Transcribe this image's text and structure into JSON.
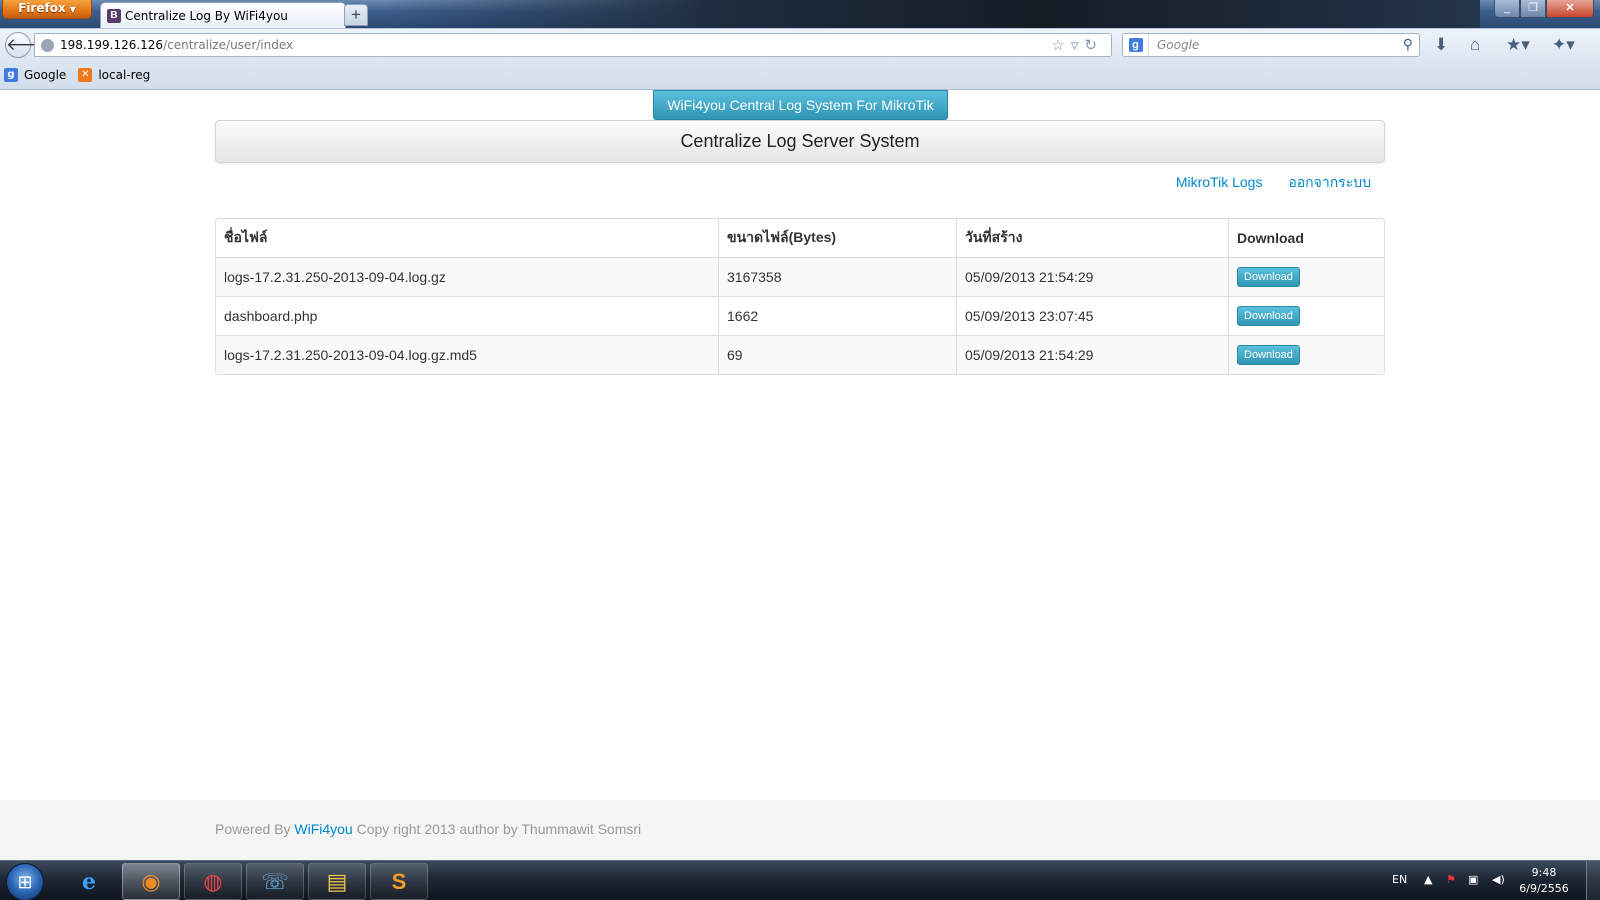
{
  "browser": {
    "menu_label": "Firefox",
    "tab_title": "Centralize Log By WiFi4you",
    "tab_favicon_letter": "B",
    "new_tab_label": "+",
    "url_host": "198.199.126.126",
    "url_path": "/centralize/user/index",
    "search_engine": "Google",
    "search_placeholder": "Google",
    "bookmarks": [
      {
        "label": "Google",
        "icon": "google-icon",
        "color": "#3f7be0"
      },
      {
        "label": "local-reg",
        "icon": "xampp-icon",
        "color": "#f07a1a"
      }
    ]
  },
  "page": {
    "brand_button": "WiFi4you Central Log System For MikroTik",
    "hero_title": "Centralize Log Server System",
    "links": {
      "mikrotik_logs": "MikroTik Logs",
      "logout": "ออกจากระบบ"
    },
    "table": {
      "headers": [
        "ชื่อไฟล์",
        "ขนาดไฟล์(Bytes)",
        "วันที่สร้าง",
        "Download"
      ],
      "rows": [
        {
          "name": "logs-17.2.31.250-2013-09-04.log.gz",
          "size": "3167358",
          "created": "05/09/2013 21:54:29",
          "action": "Download"
        },
        {
          "name": "dashboard.php",
          "size": "1662",
          "created": "05/09/2013 23:07:45",
          "action": "Download"
        },
        {
          "name": "logs-17.2.31.250-2013-09-04.log.gz.md5",
          "size": "69",
          "created": "05/09/2013 21:54:29",
          "action": "Download"
        }
      ]
    },
    "footer": {
      "prefix": "Powered By",
      "brand": "WiFi4you",
      "suffix": "Copy right 2013 author by Thummawit Somsri"
    }
  },
  "taskbar": {
    "language": "EN",
    "time": "9:48",
    "date": "6/9/2556"
  },
  "colors": {
    "accent": "#2f96b4",
    "link": "#0088cc",
    "firefox_orange": "#e4791c"
  }
}
